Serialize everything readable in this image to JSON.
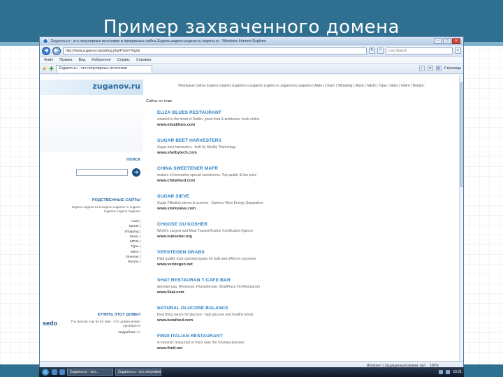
{
  "slide": {
    "title": "Пример захваченного домена"
  },
  "browser": {
    "title_text": "Zuganov.ru - это популярные источники и прекрасные сайты Zugeno.zugeno.zugeno.ru zugeno.ru - Windows Internet Explorer",
    "window_buttons": {
      "minimize": "–",
      "maximize": "□",
      "close": "×"
    },
    "address": "http://www.zuganov.ru/parking.php4?ses=7kgnb",
    "search_placeholder": "Live Search",
    "menu": [
      "Файл",
      "Правка",
      "Вид",
      "Избранное",
      "Сервис",
      "Справка"
    ],
    "tab_label": "Zuganov.ru - это популярные источники",
    "tools": {
      "page_label": "Страница"
    },
    "status": {
      "zone": "Интернет | Защищенный режим: вкл",
      "zoom": "100%"
    }
  },
  "site": {
    "logo": "zuganov.ru",
    "topnav": "Реальные сайты Zugeno zugeno.zuganov.ru zuganov zugeno.ru zuganov.ru zuganov | Азия | Спорт | Shopping | Music | Mp3s | Туры | Skies | Intern | Вопрос",
    "sites_label": "Сайты по теме",
    "search_label": "ПОИСК",
    "search_go": "➔",
    "related_title": "РОДСТВЕННЫЕ САЙТЫ",
    "related_desc": "Zugeno zugeno.ru & zugeno zuganov ru zugeno zuganov zugeno zuganov",
    "related_links": [
      "Азия |",
      "Sports |",
      "Shopping |",
      "Music |",
      "MP3s |",
      "Туры |",
      "Skies |",
      "Sinemas |",
      "Rooms |"
    ],
    "buy_title": "КУПИТЬ ЭТОТ ДОМЕН",
    "sedo": "sedo",
    "buy_desc": "The domain may be for sale - этот домен можно приобрести",
    "buy_more": "Подробнее >>",
    "results": [
      {
        "title": "ELIZA BLUES RESTAURANT",
        "desc": "situated in the heart of Dublin, great food & ambience, book online",
        "url": "www.elizablues.com"
      },
      {
        "title": "SUGAR BEET HARVESTERS",
        "desc": "Sugar beet harvesters - built by Shelby Technology",
        "url": "www.shelbytech.com"
      },
      {
        "title": "CHINA SWEETENER MAFR",
        "desc": "makers of innovative special sweeteners. Top quality & low price",
        "url": "www.chinafood.com"
      },
      {
        "title": "SUGAR SIEVE",
        "desc": "Sugar Filtration sieves & screens - Sweeco Vibro Energy Separators",
        "url": "www.storksieve.com"
      },
      {
        "title": "CHOOSE OU KOSHER",
        "desc": "World's Largest and Most Trusted Kosher Certification Agency",
        "url": "www.oukosher.org"
      },
      {
        "title": "VERSTEGEN GRABS",
        "desc": "High quality rope operated grabs for bulk and offshore purposes",
        "url": "www.verstegen.net"
      },
      {
        "title": "SHAT RESTAURAN T-CAFE-BAR",
        "desc": "вкусная еда. Японская, Итальянская, ShadPlace.Ver.Restaurant",
        "url": "www.5kat.com"
      },
      {
        "title": "NATURAL GLUCOSE BALANCE",
        "desc": "Best thing nature for glucose - high glucose and healthy levels",
        "url": "www.betafood.com"
      },
      {
        "title": "FINDI ITALIAN RESTAURANT",
        "desc": "A romantic restaurant in Paris near the Champs-Elysees",
        "url": "www.findi.net"
      }
    ]
  },
  "taskbar": {
    "tasks": [
      "Zuganov.ru - это...",
      "Zuganov.ru - это популярные..."
    ],
    "clock": "16:21"
  },
  "colors": {
    "header": "#2f6f8f",
    "link_blue": "#2b7fc2",
    "section_blue": "#2a6aa2"
  }
}
